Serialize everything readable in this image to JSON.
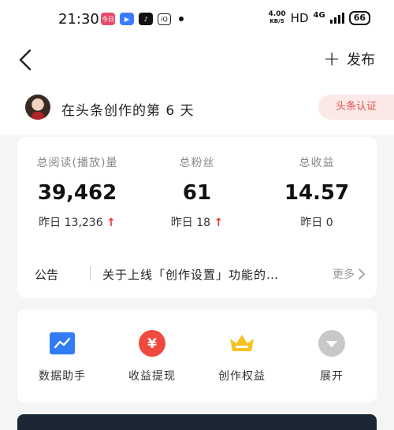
{
  "status": {
    "time": "21:30",
    "apps": [
      {
        "name": "app-icon-1",
        "text": "今日",
        "color": "#e84b6b"
      },
      {
        "name": "app-icon-2",
        "text": "▶",
        "color": "#3a7bff"
      },
      {
        "name": "tiktok-icon",
        "text": "♪",
        "color": "#111111"
      },
      {
        "name": "iqiyi-icon",
        "text": "iQ",
        "color": "#222222"
      }
    ],
    "net_speed_value": "4.00",
    "net_speed_unit": "KB/S",
    "hd": "HD",
    "network": "4G",
    "battery": "66"
  },
  "nav": {
    "publish_label": "发布"
  },
  "creator": {
    "days_text": "在头条创作的第 6 天",
    "cert_label": "头条认证"
  },
  "stats": [
    {
      "label": "总阅读(播放)量",
      "value": "39,462",
      "yest_label": "昨日",
      "yest_value": "13,236",
      "trend": "up"
    },
    {
      "label": "总粉丝",
      "value": "61",
      "yest_label": "昨日",
      "yest_value": "18",
      "trend": "up"
    },
    {
      "label": "总收益",
      "value": "14.57",
      "yest_label": "昨日",
      "yest_value": "0",
      "trend": ""
    }
  ],
  "notice": {
    "label": "公告",
    "text": "关于上线「创作设置」功能的…",
    "more_label": "更多"
  },
  "tools": [
    {
      "label": "数据助手",
      "icon": "chart-icon",
      "color": "#2f7cf6"
    },
    {
      "label": "收益提现",
      "icon": "yuan-icon",
      "color": "#f04a3e"
    },
    {
      "label": "创作权益",
      "icon": "crown-icon",
      "color": "#f7c322"
    },
    {
      "label": "展开",
      "icon": "expand-icon",
      "color": "#c8c8c8"
    }
  ]
}
